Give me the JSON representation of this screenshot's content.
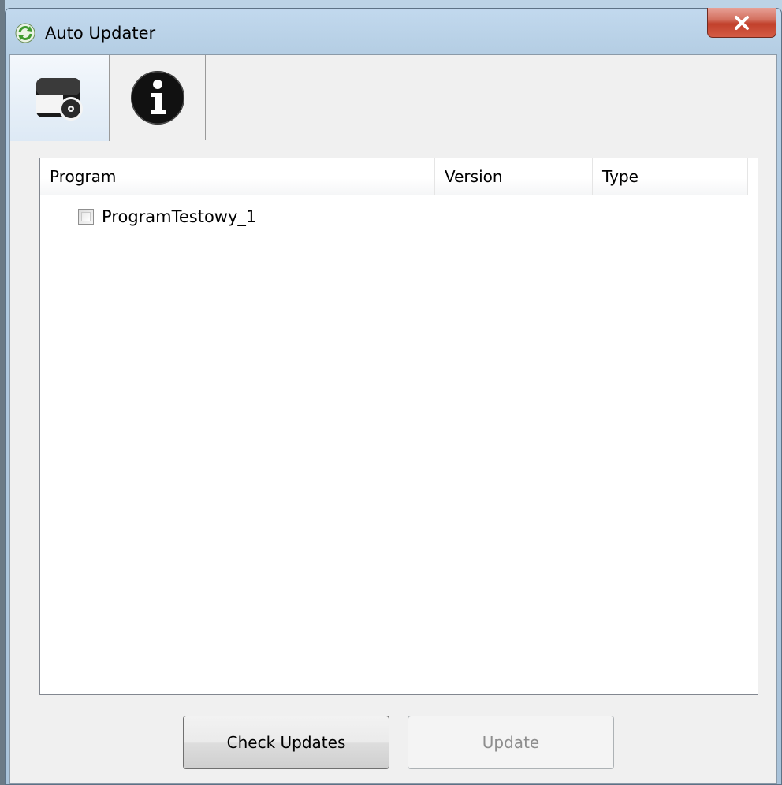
{
  "window": {
    "title": "Auto Updater",
    "close_icon": "close-icon"
  },
  "tabs": [
    {
      "id": "programs",
      "icon": "programs-disc-icon",
      "selected": true
    },
    {
      "id": "info",
      "icon": "info-icon",
      "selected": false
    }
  ],
  "list": {
    "columns": [
      "Program",
      "Version",
      "Type"
    ],
    "rows": [
      {
        "program": "ProgramTestowy_1",
        "version": "",
        "type": "",
        "checked": false
      }
    ]
  },
  "buttons": {
    "check_updates": "Check Updates",
    "update": "Update",
    "update_enabled": false
  },
  "colors": {
    "title_bar": "#b4cde3",
    "close_button": "#c1402b",
    "selected_tab": "#dde9f5"
  }
}
